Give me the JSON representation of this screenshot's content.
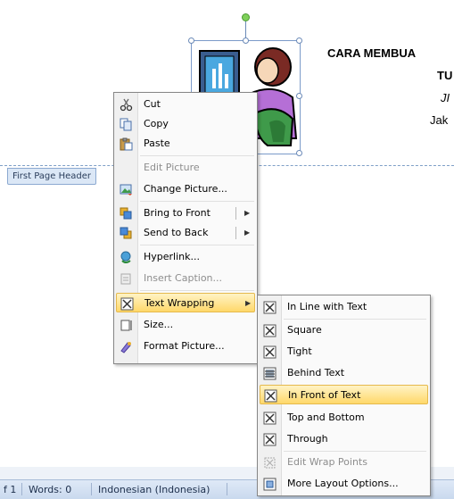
{
  "document": {
    "lines": [
      "CARA MEMBUA",
      "TU",
      "JI",
      "Jak"
    ],
    "header_tab_label": "First Page Header"
  },
  "context_menu": {
    "items": [
      {
        "label": "Cut",
        "icon": "scissors-icon",
        "disabled": false
      },
      {
        "label": "Copy",
        "icon": "copy-icon",
        "disabled": false
      },
      {
        "label": "Paste",
        "icon": "paste-icon",
        "disabled": false
      },
      {
        "label": "Edit Picture",
        "icon": "",
        "disabled": true
      },
      {
        "label": "Change Picture...",
        "icon": "change-picture-icon",
        "disabled": false
      },
      {
        "label": "Bring to Front",
        "icon": "bring-to-front-icon",
        "disabled": false
      },
      {
        "label": "Send to Back",
        "icon": "send-to-back-icon",
        "disabled": false
      },
      {
        "label": "Hyperlink...",
        "icon": "hyperlink-icon",
        "disabled": false
      },
      {
        "label": "Insert Caption...",
        "icon": "caption-icon",
        "disabled": true
      },
      {
        "label": "Text Wrapping",
        "icon": "text-wrapping-icon",
        "disabled": false
      },
      {
        "label": "Size...",
        "icon": "size-icon",
        "disabled": false
      },
      {
        "label": "Format Picture...",
        "icon": "format-picture-icon",
        "disabled": false
      }
    ]
  },
  "submenu": {
    "items": [
      {
        "label": "In Line with Text",
        "icon": "wrap-inline-icon",
        "disabled": false
      },
      {
        "label": "Square",
        "icon": "wrap-square-icon",
        "disabled": false
      },
      {
        "label": "Tight",
        "icon": "wrap-tight-icon",
        "disabled": false
      },
      {
        "label": "Behind Text",
        "icon": "wrap-behind-icon",
        "disabled": false
      },
      {
        "label": "In Front of Text",
        "icon": "wrap-front-icon",
        "disabled": false
      },
      {
        "label": "Top and Bottom",
        "icon": "wrap-top-bottom-icon",
        "disabled": false
      },
      {
        "label": "Through",
        "icon": "wrap-through-icon",
        "disabled": false
      },
      {
        "label": "Edit Wrap Points",
        "icon": "edit-wrap-points-icon",
        "disabled": true
      },
      {
        "label": "More Layout Options...",
        "icon": "layout-options-icon",
        "disabled": false
      }
    ]
  },
  "statusbar": {
    "page": "f 1",
    "words": "Words: 0",
    "language": "Indonesian (Indonesia)"
  },
  "colors": {
    "highlight": "#ffd86a",
    "status_bg": "#c9d9ee"
  }
}
